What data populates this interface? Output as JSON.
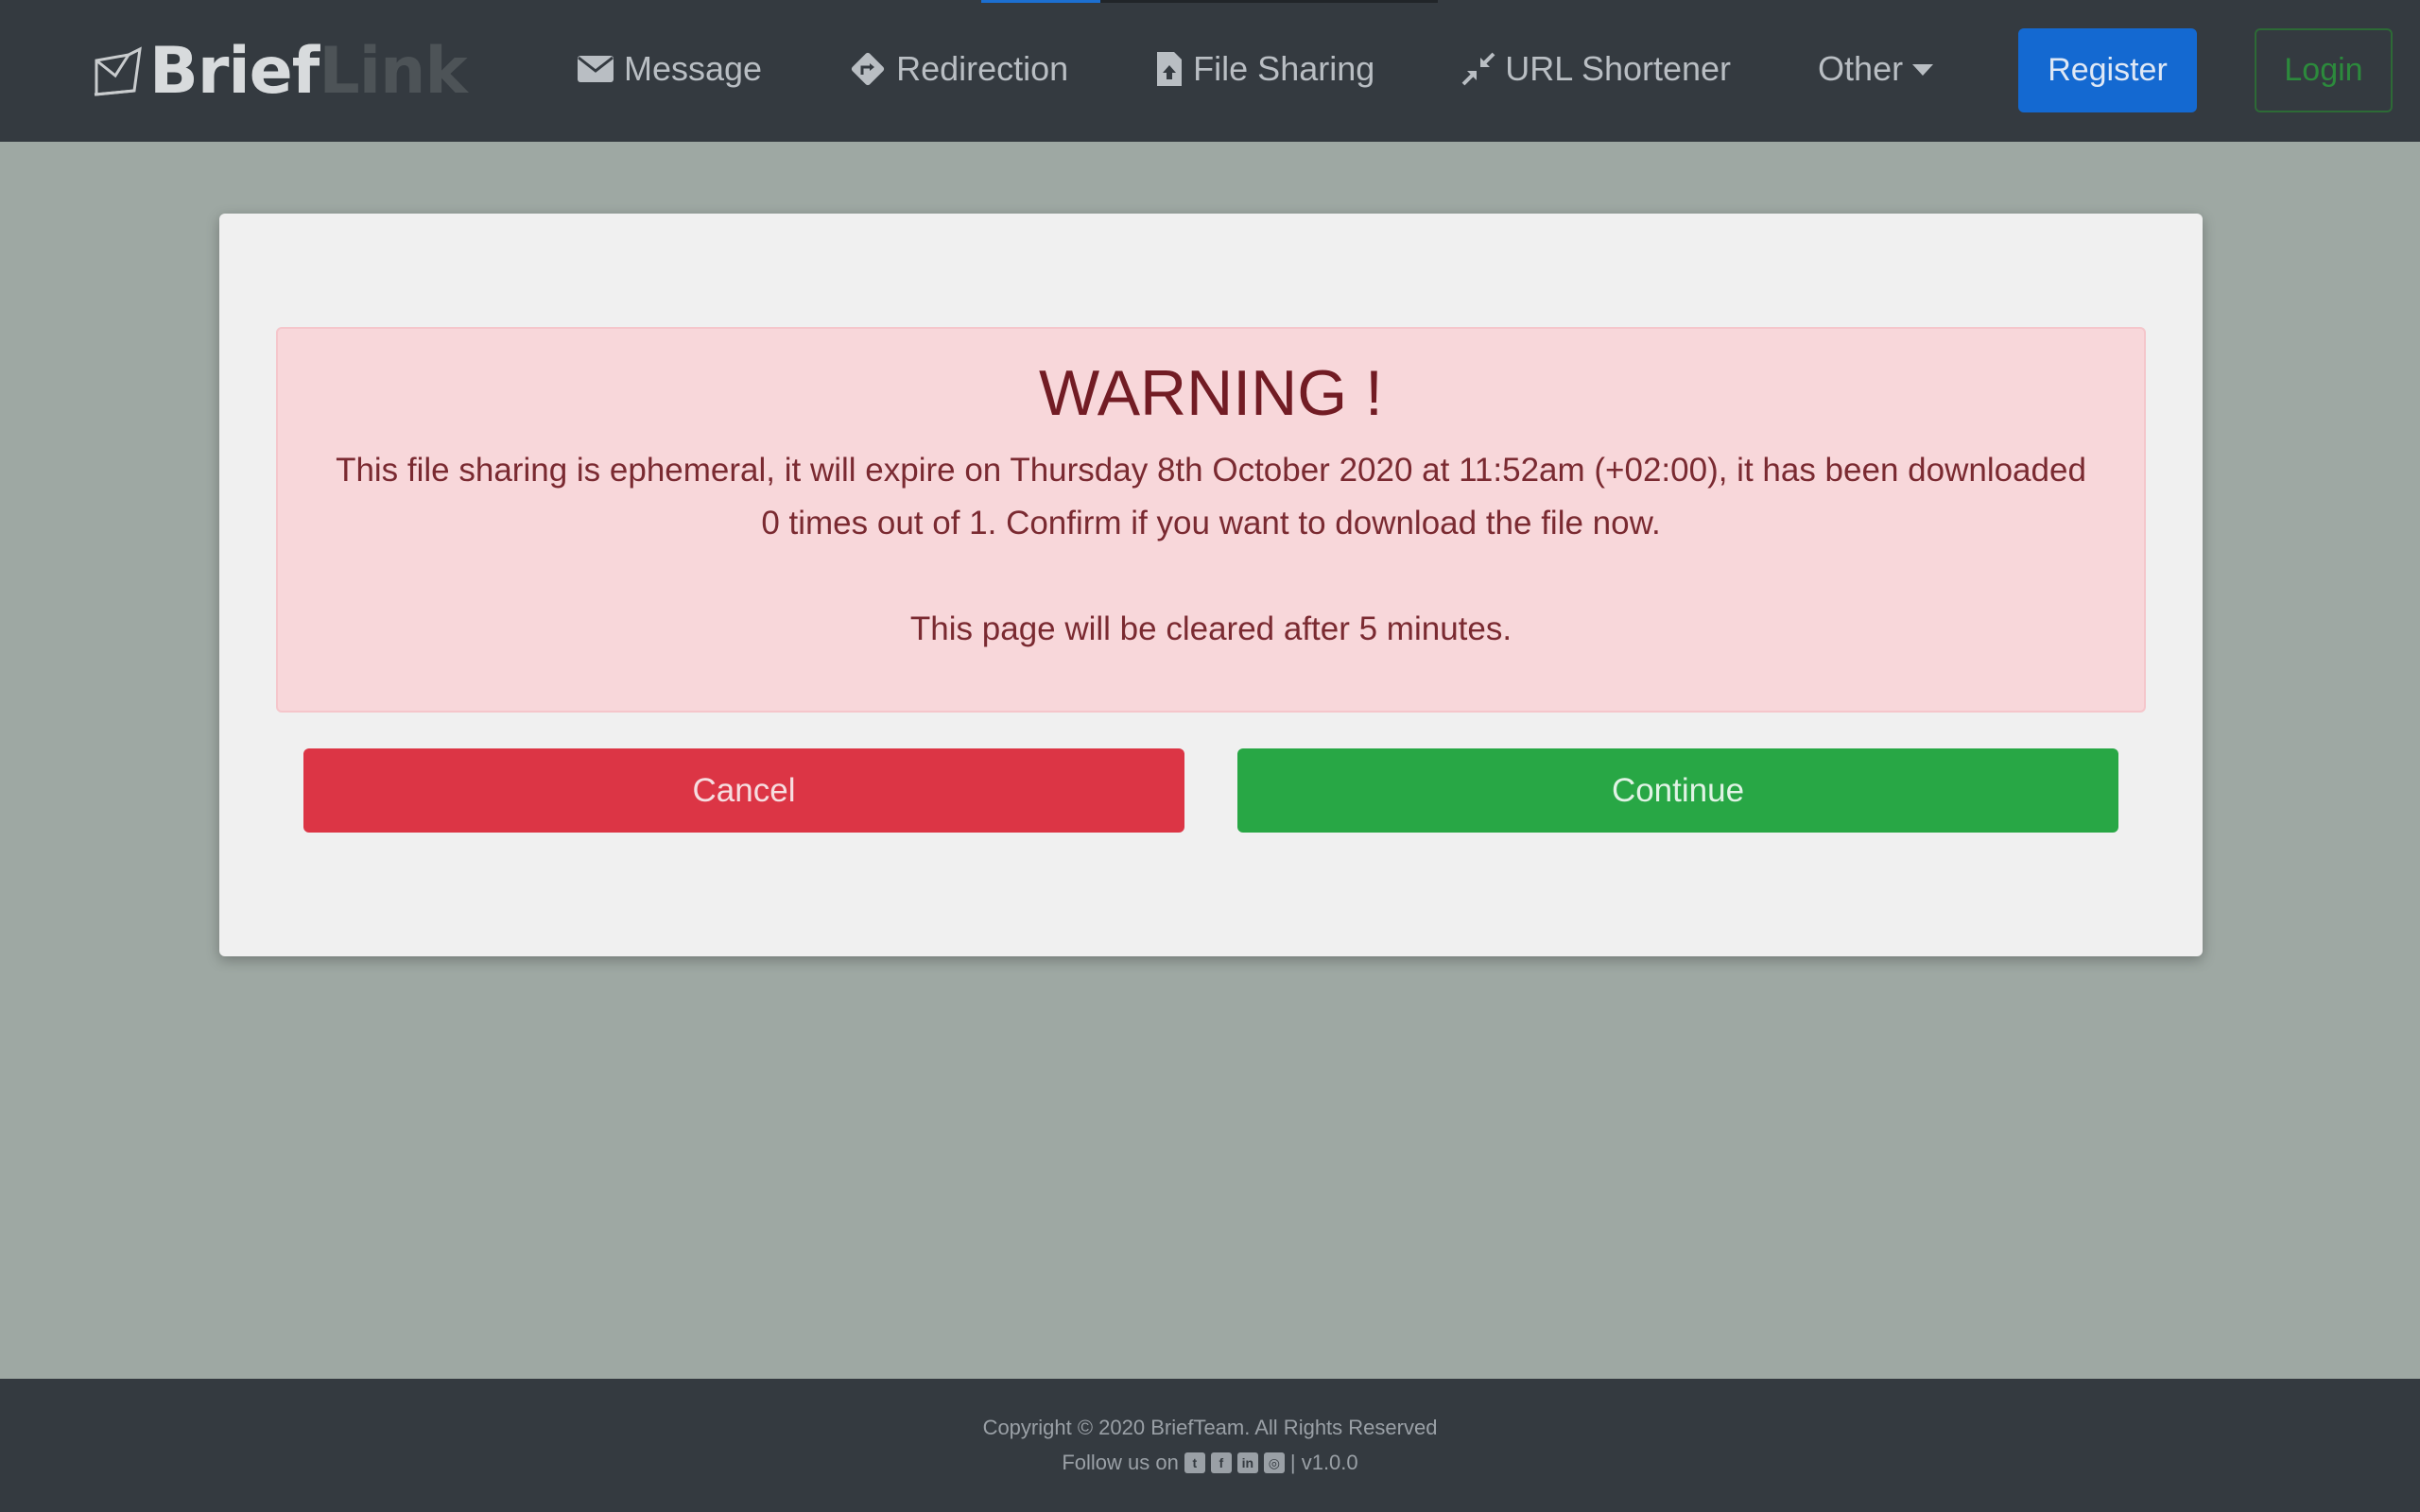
{
  "progress": {
    "fraction": 0.26
  },
  "brand": {
    "part1": "Brief",
    "part2": "Link"
  },
  "nav": {
    "items": [
      {
        "label": "Message",
        "icon": "envelope-icon"
      },
      {
        "label": "Redirection",
        "icon": "directions-icon"
      },
      {
        "label": "File Sharing",
        "icon": "file-upload-icon"
      },
      {
        "label": "URL Shortener",
        "icon": "compress-arrows-icon"
      },
      {
        "label": "Other",
        "icon": "caret-down-icon"
      }
    ],
    "register": "Register",
    "login": "Login"
  },
  "alert": {
    "title": "WARNING !",
    "body": "This file sharing is ephemeral, it will expire on Thursday 8th October 2020 at 11:52am (+02:00), it has been downloaded 0 times out of 1. Confirm if you want to download the file now.",
    "note": "This page will be cleared after 5 minutes."
  },
  "actions": {
    "cancel": "Cancel",
    "continue": "Continue"
  },
  "footer": {
    "copyright": "Copyright © 2020 BriefTeam. All Rights Reserved",
    "follow": "Follow us on",
    "social": [
      "twitter-icon",
      "facebook-icon",
      "linkedin-icon",
      "instagram-icon"
    ],
    "version": "| v1.0.0"
  },
  "colors": {
    "navbar": "#343a40",
    "page_bg": "#9ea8a3",
    "primary": "#1469d1",
    "danger": "#dc3545",
    "success": "#28a745",
    "alert_bg": "#f8d7da"
  }
}
